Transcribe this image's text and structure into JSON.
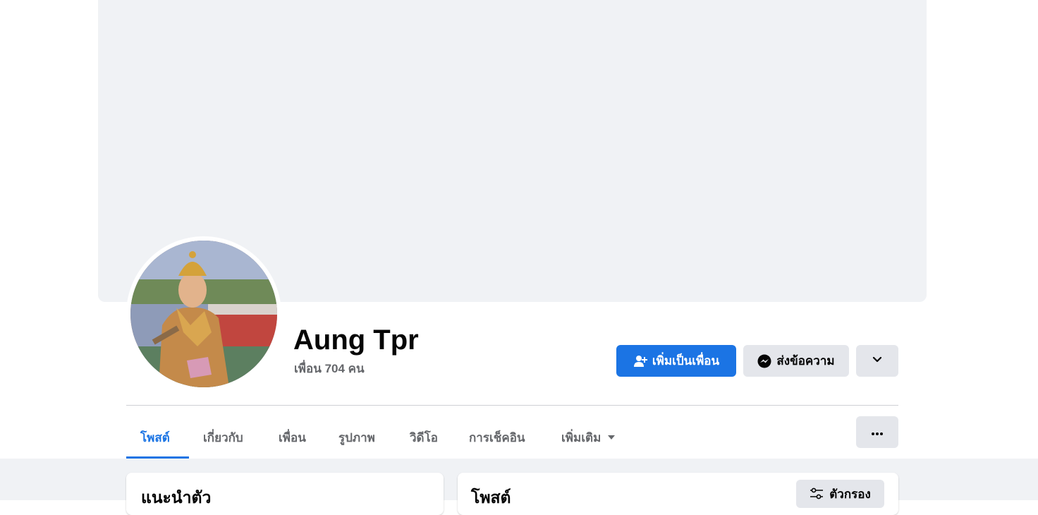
{
  "profile": {
    "name": "Aung Tpr",
    "friends_text": "เพื่อน 704 คน",
    "avatar_icon": "profile-avatar-image"
  },
  "actions": {
    "add_friend_label": "เพิ่มเป็นเพื่อน",
    "add_friend_icon": "user-plus-icon",
    "message_label": "ส่งข้อความ",
    "message_icon": "messenger-icon",
    "more_icon": "chevron-down-icon",
    "options_icon": "ellipsis-icon"
  },
  "tabs": [
    {
      "label": "โพสต์",
      "active": true
    },
    {
      "label": "เกี่ยวกับ",
      "active": false
    },
    {
      "label": "เพื่อน",
      "active": false
    },
    {
      "label": "รูปภาพ",
      "active": false
    },
    {
      "label": "วิดีโอ",
      "active": false
    },
    {
      "label": "การเช็คอิน",
      "active": false
    },
    {
      "label": "เพิ่มเติม",
      "active": false,
      "dropdown": true
    }
  ],
  "cards": {
    "intro_title": "แนะนำตัว",
    "posts_title": "โพสต์",
    "filter_label": "ตัวกรอง",
    "filter_icon": "sliders-icon"
  },
  "colors": {
    "accent": "#1b74e4",
    "secondary_button": "#e4e6eb",
    "page_background": "#f0f2f5",
    "muted_text": "#65676b"
  }
}
